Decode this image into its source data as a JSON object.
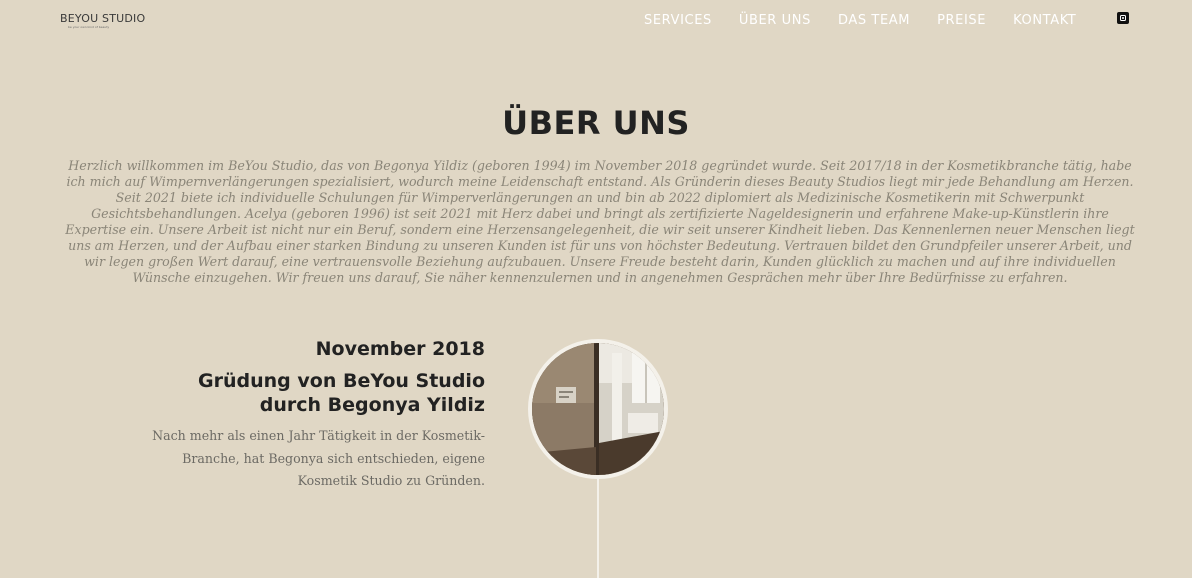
{
  "header": {
    "logo_text": "BEYOU STUDIO",
    "logo_tagline": "be your own kind of beauty",
    "nav": [
      "SERVICES",
      "ÜBER UNS",
      "DAS TEAM",
      "PREISE",
      "KONTAKT"
    ],
    "social_icon": "instagram-icon"
  },
  "about": {
    "title": "ÜBER UNS",
    "intro": "Herzlich willkommen im BeYou Studio, das von Begonya Yildiz (geboren 1994) im November 2018 gegründet wurde. Seit 2017/18 in der Kosmetikbranche tätig, habe ich mich auf Wimpernverlängerungen spezialisiert, wodurch meine Leidenschaft entstand. Als Gründerin dieses Beauty Studios liegt mir jede Behandlung am Herzen. Seit 2021 biete ich individuelle Schulungen für Wimperverlängerungen an und bin ab 2022 diplomiert als Medizinische Kosmetikerin mit Schwerpunkt Gesichtsbehandlungen. Acelya (geboren 1996) ist seit 2021 mit Herz dabei und bringt als zertifizierte Nageldesignerin und erfahrene Make-up-Künstlerin ihre Expertise ein. Unsere Arbeit ist nicht nur ein Beruf, sondern eine Herzensangelegenheit, die wir seit unserer Kindheit lieben. Das Kennenlernen neuer Menschen liegt uns am Herzen, und der Aufbau einer starken Bindung zu unseren Kunden ist für uns von höchster Bedeutung. Vertrauen bildet den Grundpfeiler unserer Arbeit, und wir legen großen Wert darauf, eine vertrauensvolle Beziehung aufzubauen. Unsere Freude besteht darin, Kunden glücklich zu machen und auf ihre individuellen Wünsche einzugehen. Wir freuen uns darauf, Sie näher kennenzulernen und in angenehmen Gesprächen mehr über Ihre Bedürfnisse zu erfahren."
  },
  "timeline": [
    {
      "date": "November 2018",
      "title": "Grüdung von BeYou Studio durch Begonya Yildiz",
      "text": "Nach mehr als einen Jahr Tätigkeit in der Kosmetik-Branche, hat Begonya sich entschieden, eigene Kosmetik Studio zu Gründen.",
      "image": "studio-interior-photo"
    }
  ],
  "colors": {
    "background": "#e0d7c5",
    "nav_text": "#ffffff",
    "heading": "#222222",
    "intro_text": "#8a8578",
    "timeline_line": "#f4f1ea"
  }
}
